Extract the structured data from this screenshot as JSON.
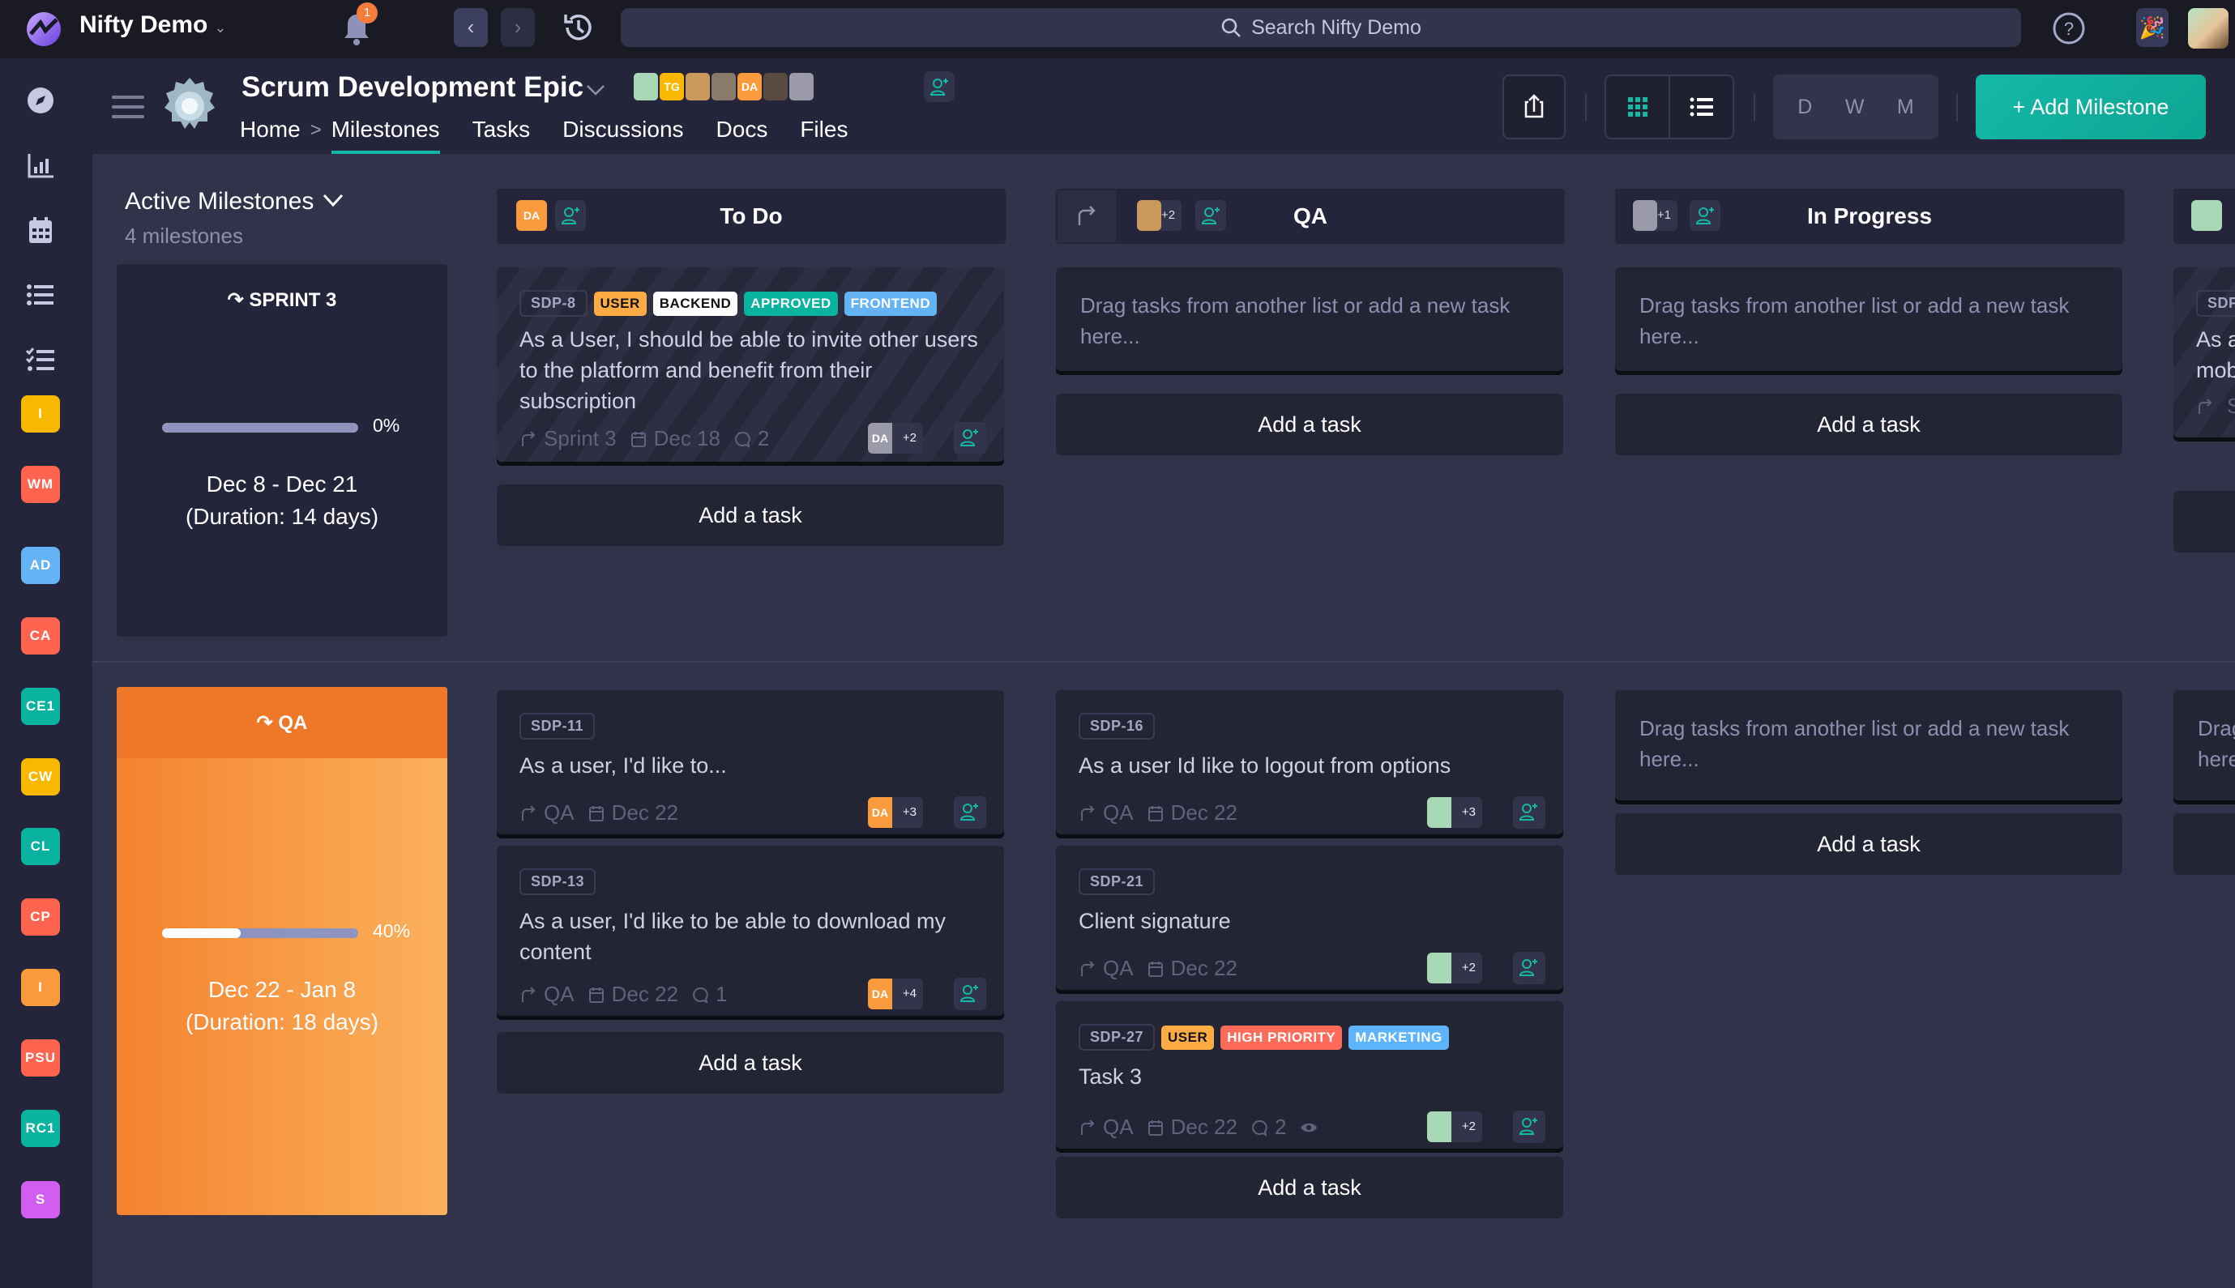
{
  "app": {
    "name": "Nifty Demo",
    "notifications": "1",
    "search_placeholder": "Search Nifty Demo"
  },
  "sidebar": {
    "nav": [
      {
        "name": "compass-icon"
      },
      {
        "name": "chart-icon"
      },
      {
        "name": "calendar-icon"
      },
      {
        "name": "list-icon"
      },
      {
        "name": "checklist-icon"
      }
    ],
    "projects": [
      {
        "label": "I",
        "color": "#f9b800"
      },
      {
        "label": "WM",
        "color": "#ff6450"
      },
      {
        "label": "AD",
        "color": "#63b3f5"
      },
      {
        "label": "CA",
        "color": "#ff6450"
      },
      {
        "label": "CE1",
        "color": "#0ab3a0"
      },
      {
        "label": "CW",
        "color": "#f9b800"
      },
      {
        "label": "CL",
        "color": "#0ab3a0"
      },
      {
        "label": "CP",
        "color": "#ff6450"
      },
      {
        "label": "I",
        "color": "#f99a3c"
      },
      {
        "label": "PSU",
        "color": "#ff6450"
      },
      {
        "label": "RC1",
        "color": "#0ab3a0"
      },
      {
        "label": "S",
        "color": "#d15ef0"
      }
    ]
  },
  "project": {
    "title": "Scrum Development Epic",
    "members": [
      {
        "initials": "",
        "color": "#a8d8b5"
      },
      {
        "initials": "TG",
        "color": "#f9b800"
      },
      {
        "initials": "",
        "color": "#c99a5b"
      },
      {
        "initials": "",
        "color": "#8a7a6a"
      },
      {
        "initials": "DA",
        "color": "#f99a3c"
      },
      {
        "initials": "",
        "color": "#5a4a40"
      },
      {
        "initials": "",
        "color": "#9a9aa8"
      }
    ],
    "tabs": {
      "home": "Home",
      "separator": ">",
      "milestones": "Milestones",
      "tasks": "Tasks",
      "discussions": "Discussions",
      "docs": "Docs",
      "files": "Files"
    },
    "view_range": [
      "D",
      "W",
      "M"
    ],
    "add_milestone": "+ Add Milestone"
  },
  "milestones": {
    "filter_label": "Active Milestones",
    "count_label": "4 milestones",
    "items": [
      {
        "name": "SPRINT 3",
        "progress_pct": 0,
        "progress_label": "0%",
        "dates": "Dec 8 - Dec 21",
        "duration": "(Duration: 14 days)"
      },
      {
        "name": "QA",
        "progress_pct": 40,
        "progress_label": "40%",
        "dates": "Dec 22 - Jan 8",
        "duration": "(Duration: 18 days)"
      }
    ]
  },
  "columns": [
    {
      "name": "To Do",
      "assignees": [
        {
          "initials": "DA",
          "color": "#f99a3c"
        }
      ],
      "extra": ""
    },
    {
      "name": "QA",
      "assignees": [
        {
          "initials": "",
          "color": "#c99a5b"
        }
      ],
      "extra": "+2"
    },
    {
      "name": "In Progress",
      "assignees": [
        {
          "initials": "",
          "color": "#9a9aa8"
        }
      ],
      "extra": "+1"
    },
    {
      "name": "",
      "assignees": [
        {
          "initials": "",
          "color": "#a8d8b5"
        }
      ],
      "extra": ""
    }
  ],
  "board": {
    "empty_text": "Drag tasks from another list or add a new task here...",
    "add_task": "Add a task",
    "row1": {
      "todo": [
        {
          "id": "SDP-8",
          "tags": [
            {
              "label": "USER",
              "bg": "#fdac45",
              "fg": "#111"
            },
            {
              "label": "BACKEND",
              "bg": "#ffffff",
              "fg": "#111"
            },
            {
              "label": "APPROVED",
              "bg": "#0ab3a0",
              "fg": "#fff"
            },
            {
              "label": "FRONTEND",
              "bg": "#63b3f5",
              "fg": "#fff"
            }
          ],
          "title": "As a User, I should be able to invite other users to the platform and benefit from their subscription",
          "milestone": "Sprint 3",
          "date": "Dec 18",
          "comments": "2",
          "assignee": {
            "initials": "DA",
            "color": "#9a9aa8"
          },
          "extra": "+2"
        }
      ],
      "partial": {
        "id": "SDP",
        "title": "As a mob",
        "milestone": "S"
      }
    },
    "row2": {
      "todo": [
        {
          "id": "SDP-11",
          "title": "As a user, I'd like to...",
          "milestone": "QA",
          "date": "Dec 22",
          "assignee": {
            "initials": "DA",
            "color": "#f99a3c"
          },
          "extra": "+3"
        },
        {
          "id": "SDP-13",
          "title": "As a user, I'd like to be able to download my content",
          "milestone": "QA",
          "date": "Dec 22",
          "comments": "1",
          "assignee": {
            "initials": "DA",
            "color": "#f99a3c"
          },
          "extra": "+4"
        }
      ],
      "qa": [
        {
          "id": "SDP-16",
          "title": "As a user Id like to logout from options",
          "milestone": "QA",
          "date": "Dec 22",
          "assignee": {
            "initials": "",
            "color": "#a8d8b5"
          },
          "extra": "+3"
        },
        {
          "id": "SDP-21",
          "title": "Client signature",
          "milestone": "QA",
          "date": "Dec 22",
          "assignee": {
            "initials": "",
            "color": "#a8d8b5"
          },
          "extra": "+2"
        },
        {
          "id": "SDP-27",
          "tags": [
            {
              "label": "USER",
              "bg": "#fdac45",
              "fg": "#111"
            },
            {
              "label": "HIGH PRIORITY",
              "bg": "#ff6b5b",
              "fg": "#fff"
            },
            {
              "label": "MARKETING",
              "bg": "#5db4fb",
              "fg": "#fff"
            }
          ],
          "title": "Task 3",
          "milestone": "QA",
          "date": "Dec 22",
          "comments": "2",
          "watch": true,
          "assignee": {
            "initials": "",
            "color": "#a8d8b5"
          },
          "extra": "+2"
        }
      ]
    }
  },
  "colors": {
    "accent": "#14b8a6",
    "bg": "#30334a",
    "panel": "#24253a",
    "topbar": "#1a1a24"
  }
}
